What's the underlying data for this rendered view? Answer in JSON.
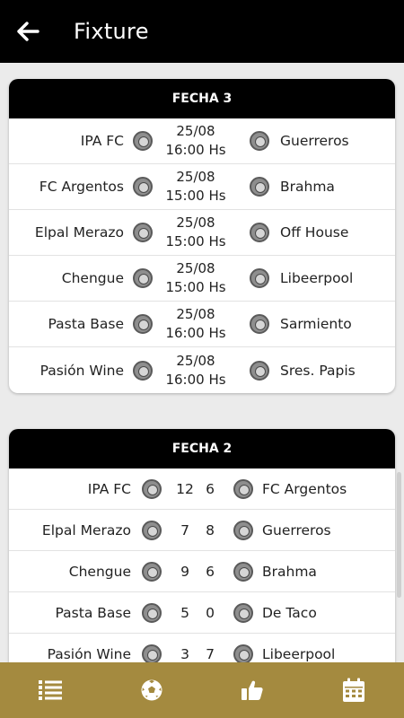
{
  "header": {
    "title": "Fixture"
  },
  "rounds": [
    {
      "label": "FECHA 3",
      "matches": [
        {
          "home": "IPA FC",
          "away": "Guerreros",
          "date": "25/08",
          "time": "16:00 Hs"
        },
        {
          "home": "FC Argentos",
          "away": "Brahma",
          "date": "25/08",
          "time": "15:00 Hs"
        },
        {
          "home": "Elpal Merazo",
          "away": "Off House",
          "date": "25/08",
          "time": "15:00 Hs"
        },
        {
          "home": "Chengue",
          "away": "Libeerpool",
          "date": "25/08",
          "time": "15:00 Hs"
        },
        {
          "home": "Pasta Base",
          "away": "Sarmiento",
          "date": "25/08",
          "time": "16:00 Hs"
        },
        {
          "home": "Pasión Wine",
          "away": "Sres. Papis",
          "date": "25/08",
          "time": "16:00 Hs"
        }
      ]
    },
    {
      "label": "FECHA 2",
      "matches": [
        {
          "home": "IPA FC",
          "home_score": "12",
          "away_score": "6",
          "away": "FC Argentos"
        },
        {
          "home": "Elpal Merazo",
          "home_score": "7",
          "away_score": "8",
          "away": "Guerreros"
        },
        {
          "home": "Chengue",
          "home_score": "9",
          "away_score": "6",
          "away": "Brahma"
        },
        {
          "home": "Pasta Base",
          "home_score": "5",
          "away_score": "0",
          "away": "De Taco"
        },
        {
          "home": "Pasión Wine",
          "home_score": "3",
          "away_score": "7",
          "away": "Libeerpool"
        }
      ]
    }
  ],
  "bottom_nav": [
    {
      "icon": "list-icon"
    },
    {
      "icon": "soccer-ball-icon"
    },
    {
      "icon": "thumbs-up-icon"
    },
    {
      "icon": "calendar-icon"
    }
  ],
  "colors": {
    "header_bg": "#000000",
    "bottom_nav_bg": "#a48a3f",
    "page_bg": "#ebebeb"
  }
}
